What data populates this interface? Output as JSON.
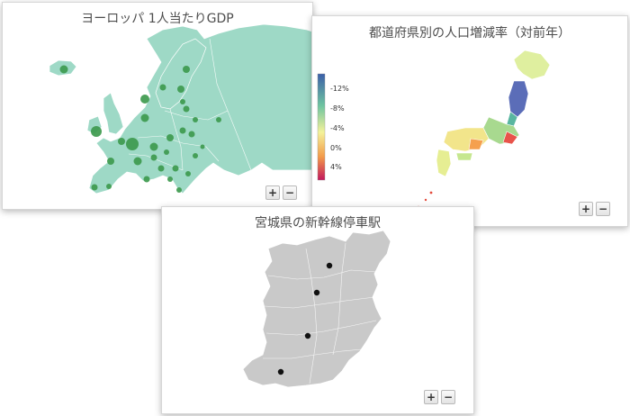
{
  "cards": {
    "europe": {
      "title": "ヨーロッパ 1人当たりGDP",
      "zoom_in": "+",
      "zoom_out": "−",
      "land_color": "#9ed9c6",
      "marker_color": "#3e9b4f"
    },
    "japan": {
      "title": "都道府県別の人口増減率（対前年）",
      "zoom_in": "+",
      "zoom_out": "−",
      "legend": {
        "labels": [
          "-12%",
          "-8%",
          "-4%",
          "0%",
          "4%"
        ],
        "colors": [
          "#3b5fa8",
          "#6ec4a0",
          "#f4f29a",
          "#f39b4a",
          "#c2185b"
        ]
      }
    },
    "miyagi": {
      "title": "宮城県の新幹線停車駅",
      "zoom_in": "+",
      "zoom_out": "−",
      "land_color": "#c9c9c9",
      "station_color": "#111111"
    }
  }
}
